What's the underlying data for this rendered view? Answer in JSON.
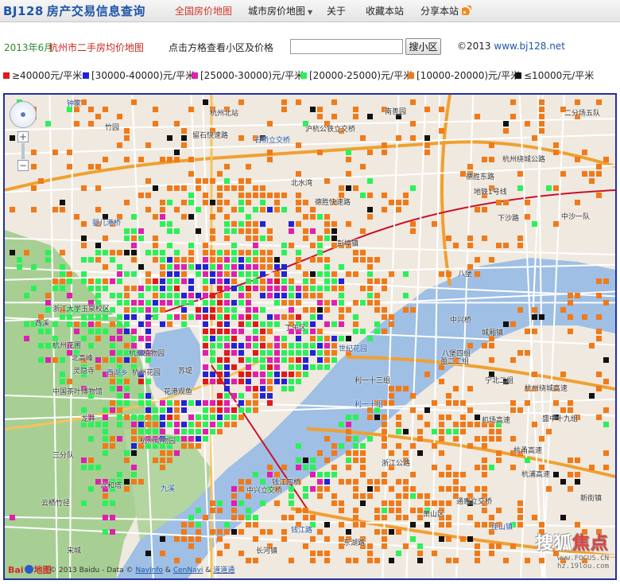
{
  "nav": {
    "brand": "BJ128",
    "brand_sub": "房产交易信息查询",
    "items": [
      {
        "label": "全国房价地图",
        "active": true
      },
      {
        "label": "城市房价地图",
        "dropdown": true
      },
      {
        "label": "关于"
      },
      {
        "label": "收藏本站"
      },
      {
        "label": "分享本站",
        "icon": "rss-icon"
      }
    ]
  },
  "info": {
    "date": "2013年6月",
    "map_title": "杭州市二手房均价地图",
    "hint": "点击方格查看小区及价格",
    "search_placeholder": "",
    "search_button": "搜小区",
    "copyright_prefix": "©2013",
    "copyright_link": "www.bj128.net"
  },
  "legend": [
    {
      "label": "≥40000元/平米",
      "color": "#e01a1a"
    },
    {
      "label": "[30000-40000)元/平米",
      "color": "#2323d6"
    },
    {
      "label": "[25000-30000)元/平米",
      "color": "#e01fae"
    },
    {
      "label": "[20000-25000)元/平米",
      "color": "#2cf05a"
    },
    {
      "label": "[10000-20000)元/平米",
      "color": "#f07a1a"
    },
    {
      "label": "≤10000元/平米",
      "color": "#111111"
    }
  ],
  "map": {
    "labels": [
      "钟家",
      "杭州北站",
      "南善园",
      "二分场五队",
      "竹园",
      "留石快速路",
      "沪杭公铁立交桥",
      "石桥立交桥",
      "杭州绕城公路",
      "北水湾",
      "德胜快速路",
      "德胜东路",
      "地铁1号线",
      "彭埠镇",
      "婴儿港桥",
      "下沙路",
      "中沙一队",
      "浙江大学玉泉校区",
      "八堡",
      "西溪",
      "丁午区",
      "世纪花园",
      "城厢镇",
      "杭州花圃",
      "杭州植物园",
      "北高峰",
      "灵隐寺",
      "杭州花园",
      "西湖乡",
      "苏堤",
      "花港观鱼",
      "中国茶叶博物馆",
      "龙井",
      "宁北二组",
      "杭州动物园",
      "利一十组",
      "利一十三组",
      "盛中十九组",
      "杭州绕城高速",
      "六和塔",
      "钱江四桥",
      "三分队",
      "九溪",
      "中兴立交桥",
      "浙江公路",
      "通惠立交桥",
      "新街镇",
      "云栖竹径",
      "萧山区",
      "佳山镇",
      "长河镇",
      "东湖路",
      "宋城",
      "机场高速",
      "杭甬高速",
      "杭浦高速",
      "钱江路",
      "八堡四组",
      "中兴桥",
      "盈二二组"
    ],
    "controls": {
      "zoom_in": "+",
      "zoom_out": "−"
    },
    "baidu_logo": "Bai",
    "baidu_logo_suffix": "地图",
    "copyright_text": "© 2013 Baidu - Data ©",
    "copyright_link1": "NavInfo",
    "copyright_amp": "&",
    "copyright_link2": "CenNavi",
    "copyright_link3": "道道通",
    "watermark_main": "搜狐",
    "watermark_accent": "焦点",
    "watermark_sub": "www.FOCUS.CN",
    "watermark_sub2": "hz.19lou.com"
  }
}
